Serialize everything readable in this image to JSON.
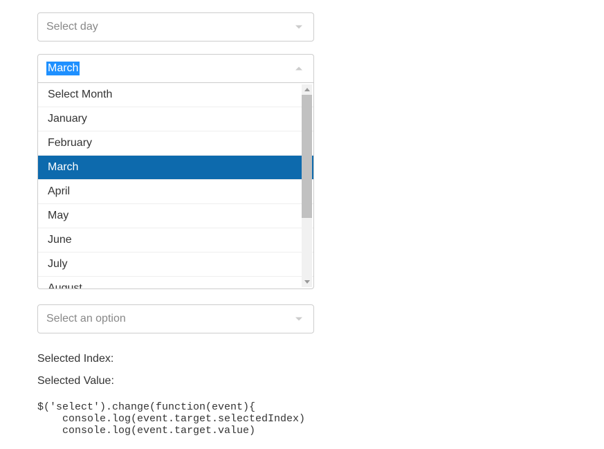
{
  "daySelect": {
    "placeholder": "Select day"
  },
  "monthSelect": {
    "value": "March",
    "options": [
      "Select Month",
      "January",
      "February",
      "March",
      "April",
      "May",
      "June",
      "July",
      "August"
    ],
    "selectedIndex": 3
  },
  "optionSelect": {
    "placeholder": "Select an option"
  },
  "labels": {
    "selectedIndex": "Selected Index:",
    "selectedValue": "Selected Value:"
  },
  "code": "$('select').change(function(event){\n    console.log(event.target.selectedIndex)\n    console.log(event.target.value)"
}
